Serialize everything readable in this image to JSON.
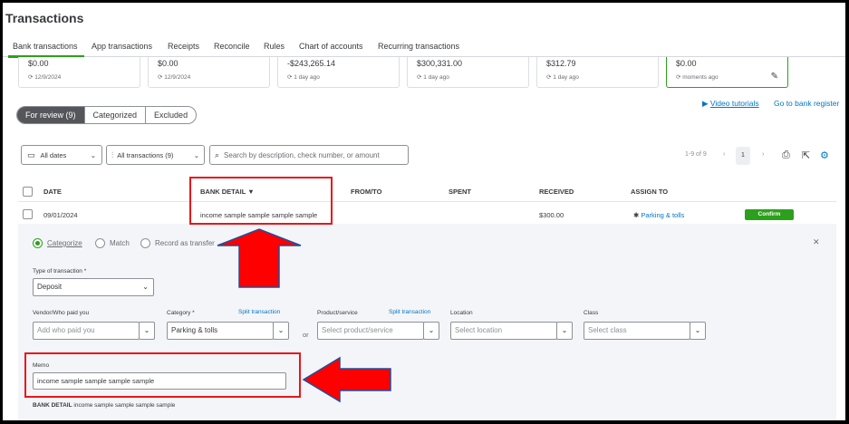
{
  "page": {
    "title": "Transactions"
  },
  "nav_tabs": [
    {
      "label": "Bank transactions",
      "active": true
    },
    {
      "label": "App transactions"
    },
    {
      "label": "Receipts"
    },
    {
      "label": "Reconcile"
    },
    {
      "label": "Rules"
    },
    {
      "label": "Chart of accounts"
    },
    {
      "label": "Recurring transactions"
    }
  ],
  "accounts": [
    {
      "amount": "$0.00",
      "updated": "12/9/2024"
    },
    {
      "amount": "$0.00",
      "updated": "12/9/2024"
    },
    {
      "amount": "-$243,265.14",
      "updated": "1 day ago"
    },
    {
      "amount": "$300,331.00",
      "updated": "1 day ago"
    },
    {
      "amount": "$312.79",
      "updated": "1 day ago"
    },
    {
      "amount": "$0.00",
      "updated": "moments ago",
      "selected": true
    }
  ],
  "review_tabs": {
    "for_review": "For review (9)",
    "categorized": "Categorized",
    "excluded": "Excluded"
  },
  "links": {
    "video_tutorials": "Video tutorials",
    "go_to_register": "Go to bank register"
  },
  "filters": {
    "dates": "All dates",
    "transactions": "All transactions (9)",
    "search_placeholder": "Search by description, check number, or amount"
  },
  "pagination": {
    "range": "1-9 of 9",
    "page": "1"
  },
  "table": {
    "headers": {
      "date": "DATE",
      "bank_detail": "BANK DETAIL",
      "from_to": "FROM/TO",
      "spent": "SPENT",
      "received": "RECEIVED",
      "assign_to": "ASSIGN TO"
    },
    "row": {
      "date": "09/01/2024",
      "bank_detail": "income sample sample sample sample",
      "from_to": "",
      "spent": "",
      "received": "$300.00",
      "assign_to": "Parking & tolls",
      "action": "Confirm"
    }
  },
  "panel": {
    "radios": {
      "categorize": "Categorize",
      "match": "Match",
      "record_transfer": "Record as transfer"
    },
    "type_label": "Type of transaction *",
    "type_value": "Deposit",
    "vendor_label": "Vendor/Who paid you",
    "vendor_placeholder": "Add who paid you",
    "category_label": "Category *",
    "split_transaction": "Split transaction",
    "category_value": "Parking & tolls",
    "or": "or",
    "product_label": "Product/service",
    "product_split": "Split transaction",
    "product_placeholder": "Select product/service",
    "location_label": "Location",
    "location_placeholder": "Select location",
    "class_label": "Class",
    "class_placeholder": "Select class",
    "memo_label": "Memo",
    "memo_value": "income sample sample sample sample",
    "bank_detail_label": "BANK DETAIL",
    "bank_detail_value": "income sample sample sample sample"
  },
  "colors": {
    "accent": "#2ca01c",
    "link": "#0077c5",
    "annotation": "#e8161b"
  }
}
